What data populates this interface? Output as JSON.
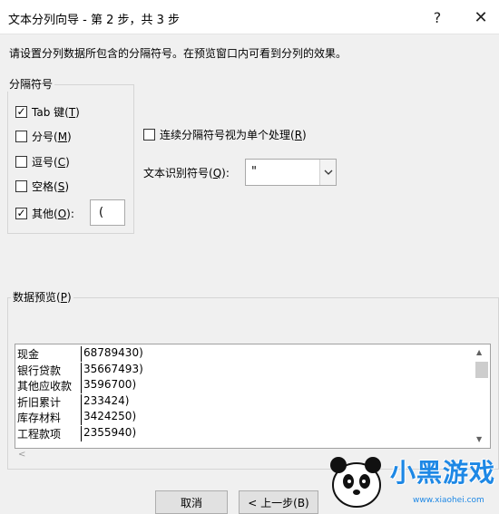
{
  "window": {
    "title": "文本分列向导 - 第 2 步，共 3 步",
    "help": "?",
    "close": "✕"
  },
  "instructions": "请设置分列数据所包含的分隔符号。在预览窗口内可看到分列的效果。",
  "delimiters": {
    "group_title": "分隔符号",
    "tab": {
      "label_pre": "Tab 键(",
      "key": "T",
      "label_post": ")",
      "checked": true
    },
    "semicolon": {
      "label_pre": "分号(",
      "key": "M",
      "label_post": ")",
      "checked": false
    },
    "comma": {
      "label_pre": "逗号(",
      "key": "C",
      "label_post": ")",
      "checked": false
    },
    "space": {
      "label_pre": "空格(",
      "key": "S",
      "label_post": ")",
      "checked": false
    },
    "other": {
      "label_pre": "其他(",
      "key": "O",
      "label_post": "):",
      "checked": true,
      "value": "("
    }
  },
  "consecutive": {
    "label_pre": "连续分隔符号视为单个处理(",
    "key": "R",
    "label_post": ")",
    "checked": false
  },
  "text_qualifier": {
    "label_pre": "文本识别符号(",
    "key": "Q",
    "label_post": "):",
    "value": "\""
  },
  "preview": {
    "title_pre": "数据预览(",
    "key": "P",
    "title_post": ")",
    "rows": [
      {
        "col1": "现金",
        "col2": "68789430)"
      },
      {
        "col1": "银行贷款",
        "col2": "35667493)"
      },
      {
        "col1": "其他应收款",
        "col2": "3596700)"
      },
      {
        "col1": "折旧累计",
        "col2": "233424)"
      },
      {
        "col1": "库存材料",
        "col2": "3424250)"
      },
      {
        "col1": "工程款项",
        "col2": "2355940)"
      }
    ]
  },
  "buttons": {
    "cancel": "取消",
    "back": "< 上一步(B)"
  },
  "watermark": {
    "text": "小黑游戏",
    "url": "www.xiaohei.com"
  },
  "icons": {
    "help": "help-icon",
    "close": "close-icon",
    "dropdown": "chevron-down-icon",
    "scroll_up": "arrow-up-icon",
    "scroll_down": "arrow-down-icon",
    "scroll_left": "arrow-left-icon"
  },
  "colors": {
    "accent": "#1e88e5",
    "window_bg": "#f0f0f0"
  }
}
